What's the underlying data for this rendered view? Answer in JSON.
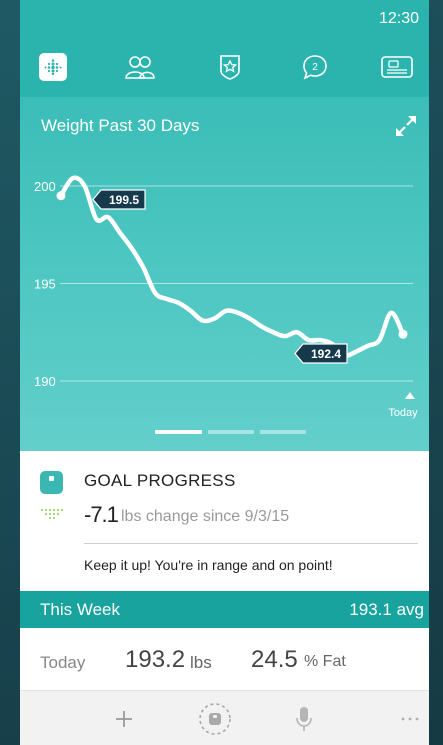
{
  "status_bar": {
    "time": "12:30"
  },
  "tabs": [
    {
      "name": "dashboard",
      "icon": "fitbit-dots-icon",
      "active": true
    },
    {
      "name": "friends",
      "icon": "friends-icon",
      "active": false
    },
    {
      "name": "challenges",
      "icon": "star-badge-icon",
      "active": false
    },
    {
      "name": "messages",
      "icon": "chat-bubble-icon",
      "badge": "2",
      "active": false
    },
    {
      "name": "account",
      "icon": "id-card-icon",
      "active": false
    }
  ],
  "chart": {
    "title": "Weight Past 30 Days",
    "y_ticks": [
      "200",
      "195",
      "190"
    ],
    "today_label": "Today",
    "callouts": {
      "high": "199.5",
      "low": "192.4"
    }
  },
  "chart_data": {
    "type": "line",
    "title": "Weight Past 30 Days",
    "xlabel": "",
    "ylabel": "",
    "ylim": [
      190,
      200
    ],
    "grid": true,
    "x": [
      1,
      2,
      3,
      4,
      5,
      6,
      7,
      8,
      9,
      10,
      11,
      12,
      13,
      14,
      15,
      16,
      17,
      18,
      19,
      20,
      21,
      22,
      23,
      24,
      25,
      26,
      27,
      28,
      29,
      30
    ],
    "series": [
      {
        "values": [
          199.5,
          200.4,
          200.0,
          198.3,
          198.4,
          197.6,
          196.8,
          195.8,
          194.5,
          194.2,
          194.0,
          193.6,
          193.1,
          193.2,
          193.6,
          193.5,
          193.2,
          192.8,
          192.5,
          192.3,
          192.5,
          192.1,
          192.1,
          191.9,
          191.3,
          191.5,
          191.8,
          192.1,
          193.5,
          192.4
        ]
      }
    ]
  },
  "pager": {
    "count": 3,
    "active": 0
  },
  "goal": {
    "title": "GOAL PROGRESS",
    "change_value": "-7.1",
    "change_text": "lbs change since 9/3/15",
    "message": "Keep it up! You're in range and on point!"
  },
  "this_week": {
    "label": "This Week",
    "avg": "193.1 avg"
  },
  "today": {
    "label": "Today",
    "weight": "193.2",
    "weight_unit": "lbs",
    "fat": "24.5",
    "fat_unit": "% Fat"
  },
  "bottom_actions": [
    "add-icon",
    "scale-sync-icon",
    "microphone-icon",
    "more-icon"
  ],
  "colors": {
    "teal": "#2bb3ae",
    "teal_dark": "#18a39e",
    "callout_bg": "#16394b"
  }
}
